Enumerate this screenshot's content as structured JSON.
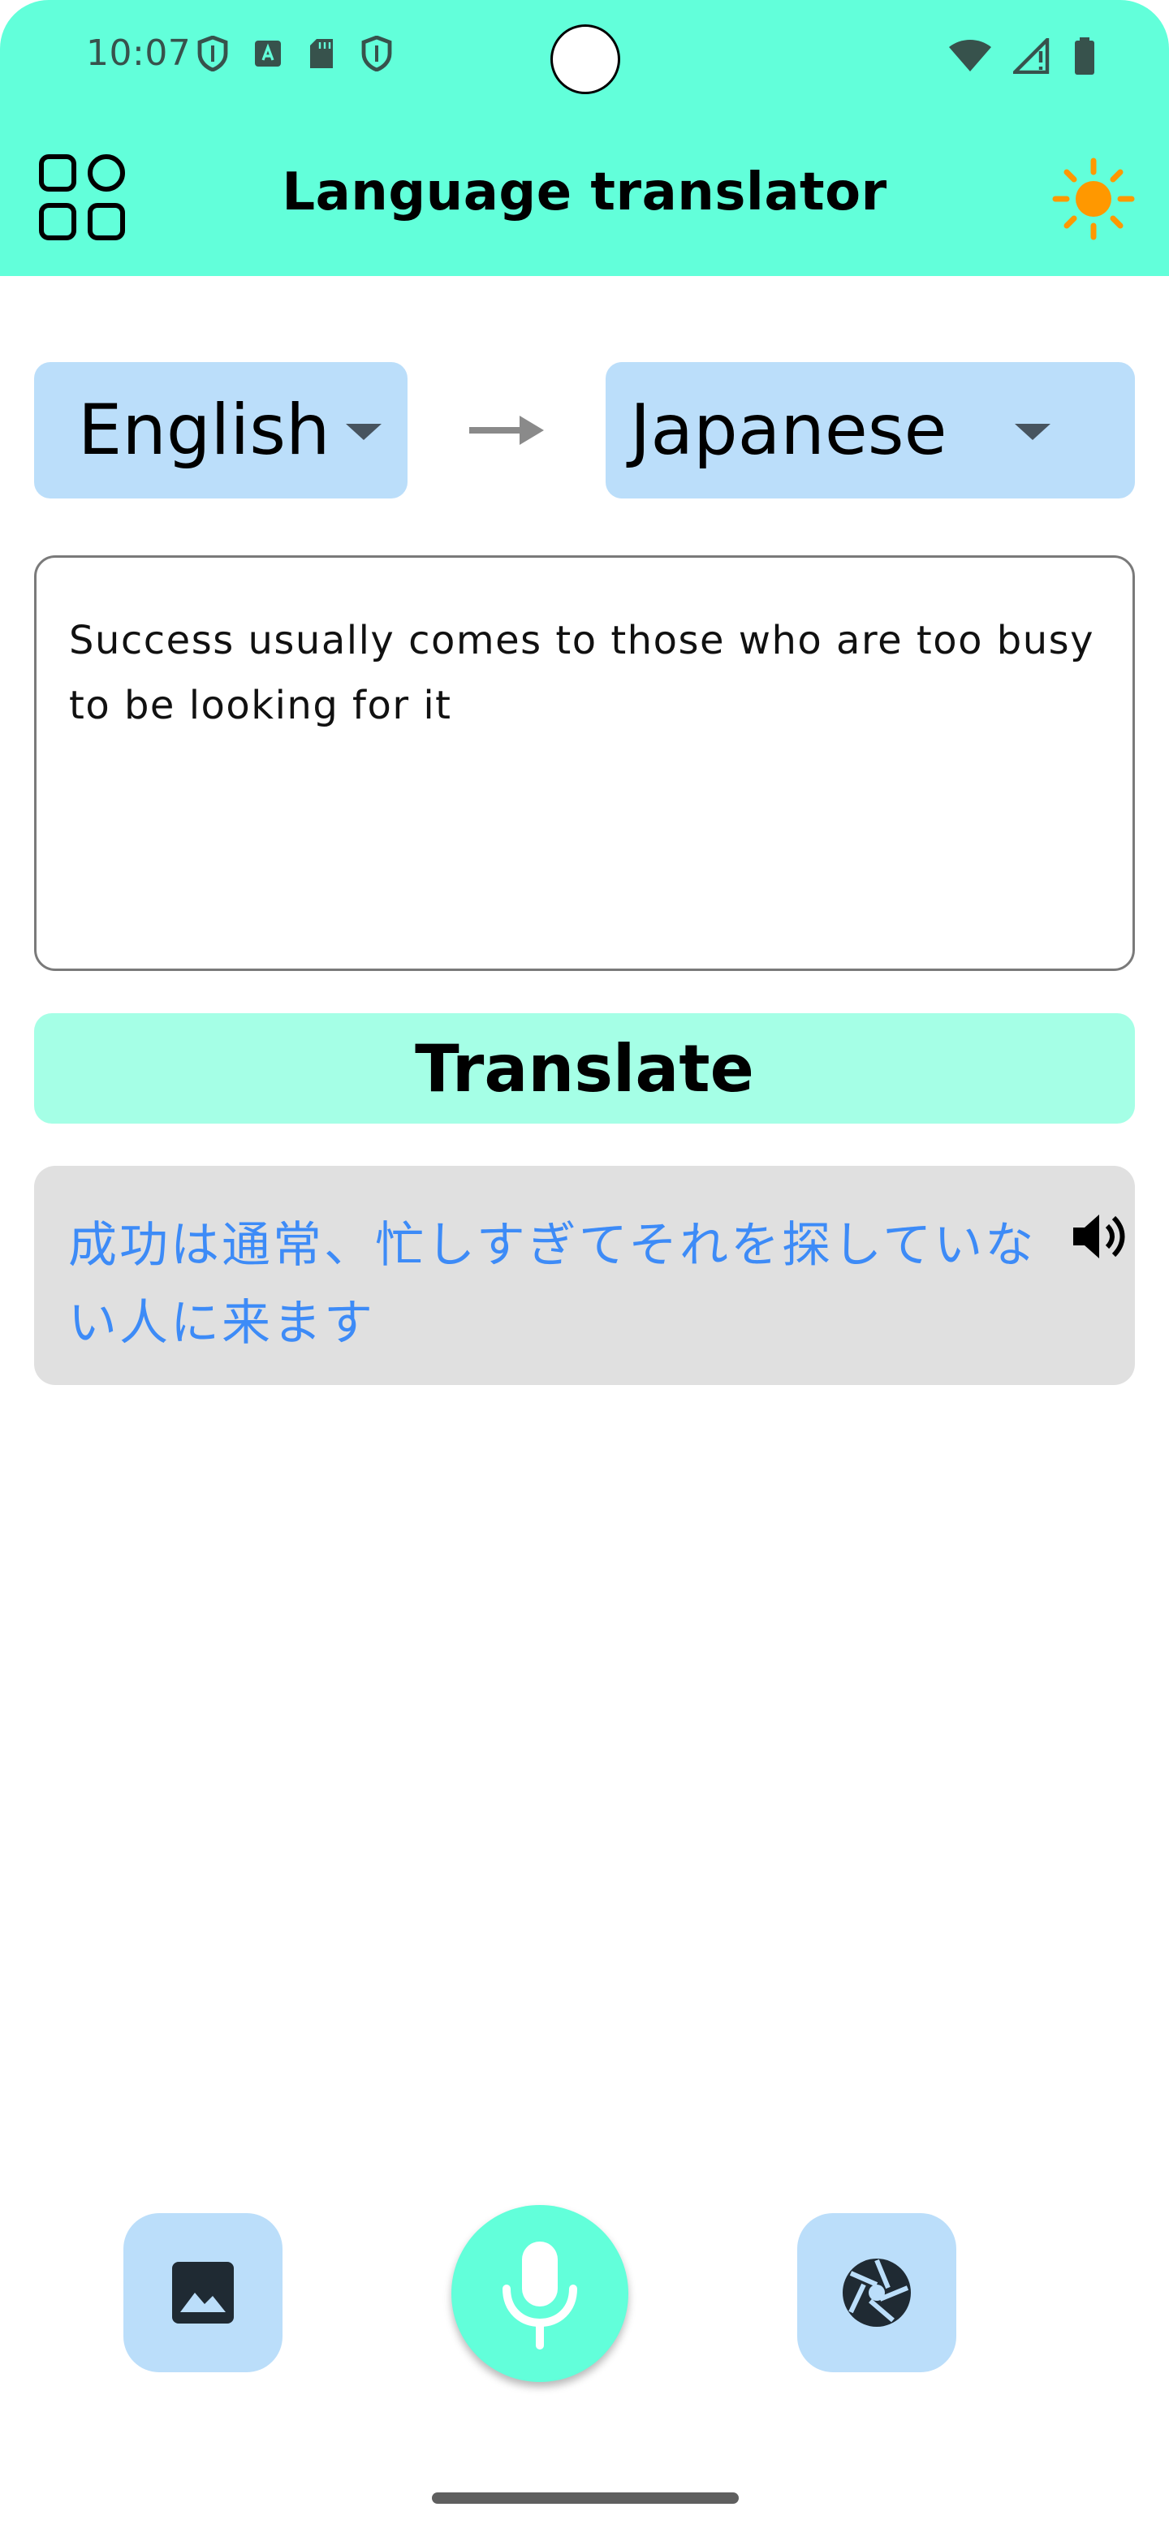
{
  "status_bar": {
    "time": "10:07"
  },
  "app_bar": {
    "title": "Language translator"
  },
  "languages": {
    "from": "English",
    "to": "Japanese"
  },
  "input": {
    "text": "Success usually comes to those who are too busy to be looking for it"
  },
  "translate_button": {
    "label": "Translate"
  },
  "output": {
    "text": "成功は通常、忙しすぎてそれを探していない人に来ます"
  },
  "icons": {
    "apps": "apps-grid-icon",
    "theme": "sun-icon",
    "arrow": "arrow-right-icon",
    "speaker": "volume-icon",
    "gallery": "image-icon",
    "mic": "microphone-icon",
    "camera": "camera-shutter-icon"
  },
  "colors": {
    "header": "#62ffda",
    "language_chip": "#bbdefa",
    "translate_button": "#a5ffe6",
    "output_background": "#e0e0e0",
    "output_text": "#3d8bf7",
    "sun": "#ff9800"
  }
}
